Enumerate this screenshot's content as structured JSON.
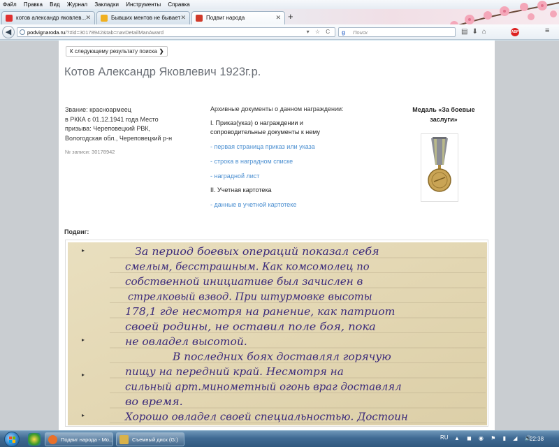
{
  "browser": {
    "menu": [
      "Файл",
      "Правка",
      "Вид",
      "Журнал",
      "Закладки",
      "Инструменты",
      "Справка"
    ],
    "tabs": [
      {
        "label": "котов александр яковлев...",
        "favicon_color": "#e03030"
      },
      {
        "label": "Бывших ментов не бывает",
        "favicon_color": "#f0b020"
      },
      {
        "label": "Подвиг народа",
        "favicon_color": "#d03a2a"
      }
    ],
    "url_host": "podvignaroda.ru",
    "url_path": "/?#id=30178942&tab=navDetailManAward",
    "search_placeholder": "Поиск",
    "search_engine_icon": "g"
  },
  "page": {
    "next_result": "К следующему результату поиска",
    "person_name": "Котов Александр Яковлевич 1923г.р.",
    "info_lines": [
      "Звание: красноармеец",
      "в РККА с 01.12.1941 года Место",
      "призыва: Череповецкий РВК,",
      "Вологодская обл., Череповецкий р-н"
    ],
    "record_no": "№ записи: 30178942",
    "archive_heading": "Архивные документы о данном награждении:",
    "section1_line1": "I. Приказ(указ) о награждении и",
    "section1_line2": "сопроводительные документы к нему",
    "link_first_page": "- первая страница приказ или указа",
    "link_list_row": "- строка в наградном списке",
    "link_award_sheet": "- наградной лист",
    "section2": "II. Учетная картотека",
    "link_card_data": "- данные в учетной картотеке",
    "medal_line1": "Медаль «За боевые",
    "medal_line2": "заслуги»",
    "feat_label": "Подвиг:",
    "document_lines": [
      "За период боевых операций показал себя",
      "смелым, бесстрашным. Как комсомолец по",
      "собственной инициативе был зачислен в",
      "стрелковый взвод. При штурмовке высоты",
      "178,1 где несмотря на ранение, как патриот",
      "своей родины, не оставил поле боя, пока",
      "не овладел высотой.",
      "В последних боях доставлял горячую",
      "пищу на передний край. Несмотря на",
      "сильный арт.минометный огонь враг доставлял",
      "во время.",
      "Хорошо овладел своей специальностью. Достоин"
    ],
    "ink_color": "#3b2a7a",
    "paper_color": "#e7dcbb"
  },
  "taskbar": {
    "tasks": [
      {
        "label": "Подвиг народа - Mo...",
        "icon_color": "#e8702a"
      },
      {
        "label": "Съемный диск (G:)",
        "icon_color": "#d9b24a"
      }
    ],
    "lang": "RU",
    "time": "22:38"
  }
}
